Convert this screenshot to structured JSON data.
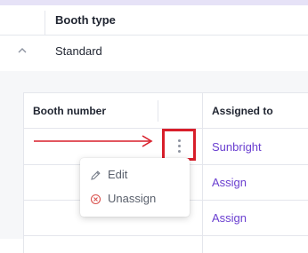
{
  "table_header": {
    "booth_type_label": "Booth type"
  },
  "group": {
    "label": "Standard"
  },
  "sub_table": {
    "columns": {
      "booth_number": "Booth number",
      "assigned_to": "Assigned to"
    },
    "rows": [
      {
        "assigned_to": "Sunbright"
      },
      {
        "assigned_to": "Assign"
      },
      {
        "assigned_to": "Assign"
      }
    ]
  },
  "menu": {
    "items": [
      {
        "label": "Edit",
        "icon": "pencil-icon"
      },
      {
        "label": "Unassign",
        "icon": "x-circle-icon"
      }
    ]
  },
  "colors": {
    "link": "#6a3fd0",
    "highlight": "#d81e2a",
    "danger_icon": "#d9534f"
  }
}
